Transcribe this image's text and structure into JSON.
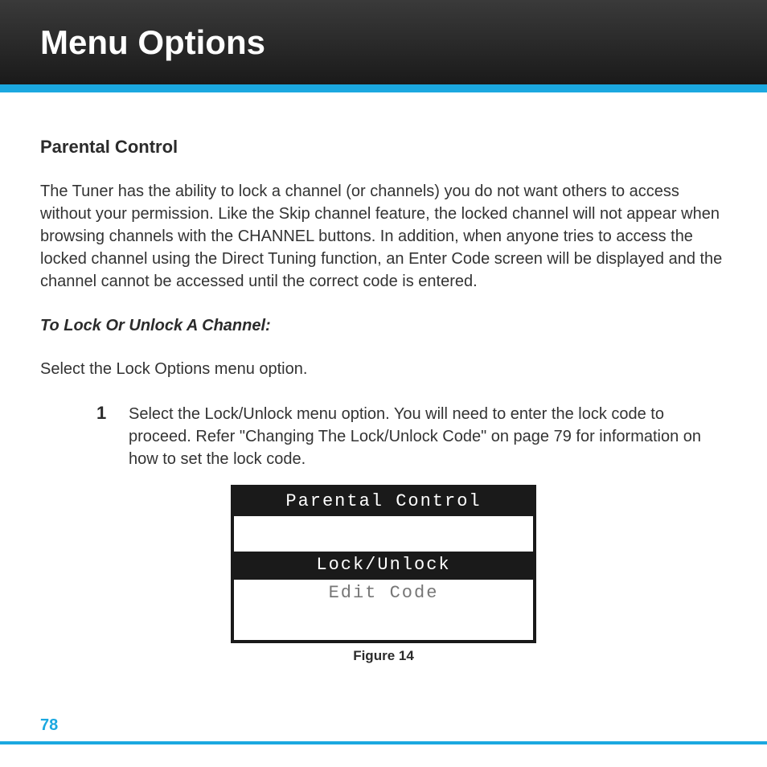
{
  "header": {
    "title": "Menu Options"
  },
  "section": {
    "title": "Parental Control",
    "intro": "The Tuner has the ability to lock a channel (or channels) you do not want others to access without your permission. Like the Skip channel feature, the locked channel will not appear when browsing channels with the CHANNEL buttons. In addition, when anyone tries to access the locked channel using the Direct Tuning function, an Enter Code screen will be displayed and the channel cannot be accessed until the correct code is entered.",
    "subheading": "To Lock Or Unlock A Channel:",
    "instruction": "Select the Lock Options menu option.",
    "steps": [
      {
        "num": "1",
        "text": "Select the Lock/Unlock menu option. You will need to enter the lock code to proceed. Refer \"Changing The Lock/Unlock Code\" on page 79 for information on how to set the lock code."
      }
    ]
  },
  "lcd": {
    "title": "Parental Control",
    "selected": "Lock/Unlock",
    "item2": "Edit Code"
  },
  "figure_caption": "Figure 14",
  "page_number": "78"
}
